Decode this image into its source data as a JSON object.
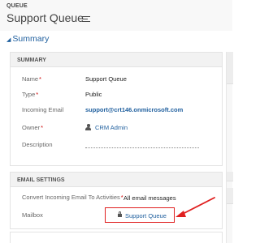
{
  "header": {
    "entity_type": "QUEUE",
    "record_title": "Support Queue"
  },
  "section": {
    "title": "Summary"
  },
  "summary": {
    "heading": "SUMMARY",
    "fields": {
      "name": {
        "label": "Name",
        "value": "Support Queue"
      },
      "type": {
        "label": "Type",
        "value": "Public"
      },
      "incoming_email": {
        "label": "Incoming Email",
        "value": "support@crt146.onmicrosoft.com"
      },
      "owner": {
        "label": "Owner",
        "value": "CRM Admin"
      },
      "description": {
        "label": "Description",
        "value": ""
      }
    },
    "required_marker": "*"
  },
  "email_settings": {
    "heading": "EMAIL SETTINGS",
    "convert": {
      "label": "Convert Incoming Email To Activities",
      "value": "All email messages"
    },
    "mailbox": {
      "label": "Mailbox",
      "value": "Support Queue"
    }
  },
  "colors": {
    "link": "#1f5f9e",
    "required": "#cc0000",
    "highlight": "#e02020"
  },
  "icons": [
    "menu-icon",
    "person-icon",
    "lock-icon",
    "caret-down-icon"
  ]
}
